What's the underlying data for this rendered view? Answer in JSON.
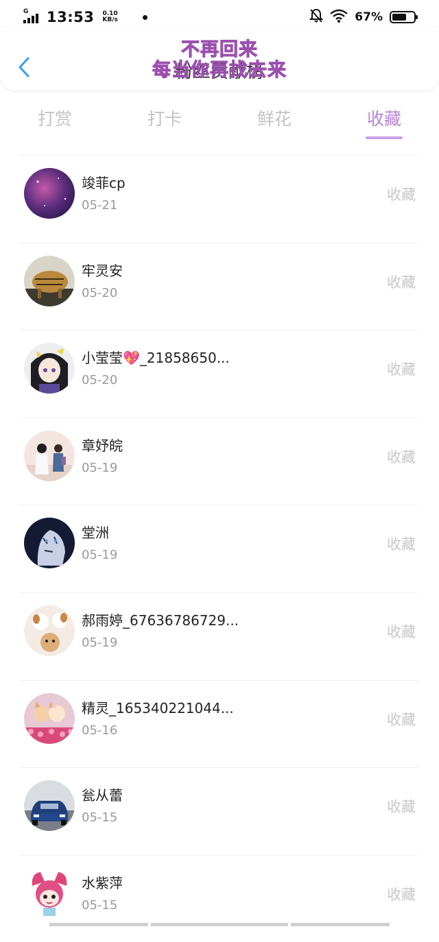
{
  "status_bar": {
    "network": "G",
    "time": "13:53",
    "speed_value": "0.10",
    "speed_unit": "KB/s",
    "battery": "67%",
    "battery_level": 0.67
  },
  "header": {
    "title": "粉丝贡献榜",
    "watermark_line1": "不再回来",
    "watermark_line2": "每当你再找去来"
  },
  "tabs": [
    {
      "label": "打赏",
      "active": false
    },
    {
      "label": "打卡",
      "active": false
    },
    {
      "label": "鲜花",
      "active": false
    },
    {
      "label": "收藏",
      "active": true
    }
  ],
  "rows": [
    {
      "name": "竣菲cp",
      "date": "05-21",
      "action": "收藏",
      "avatar": "purple-galaxy"
    },
    {
      "name": "牢灵安",
      "date": "05-20",
      "action": "收藏",
      "avatar": "tiger"
    },
    {
      "name": "小莹莹💖_21858650...",
      "date": "05-20",
      "action": "收藏",
      "avatar": "anime-girl"
    },
    {
      "name": "章妤皖",
      "date": "05-19",
      "action": "收藏",
      "avatar": "couple-walking"
    },
    {
      "name": "堂洲",
      "date": "05-19",
      "action": "收藏",
      "avatar": "white-tiger"
    },
    {
      "name": "郝雨婷_67636786729...",
      "date": "05-19",
      "action": "收藏",
      "avatar": "puppies"
    },
    {
      "name": "精灵_165340221044...",
      "date": "05-16",
      "action": "收藏",
      "avatar": "kittens-flowers"
    },
    {
      "name": "瓮从蕾",
      "date": "05-15",
      "action": "收藏",
      "avatar": "blue-car"
    },
    {
      "name": "水紫萍",
      "date": "05-15",
      "action": "收藏",
      "avatar": "cartoon-girl"
    }
  ],
  "colors": {
    "accent": "#b685d8",
    "tab_inactive": "#c3c3c3",
    "back_icon": "#3a9be6",
    "watermark": "#c879d6"
  }
}
